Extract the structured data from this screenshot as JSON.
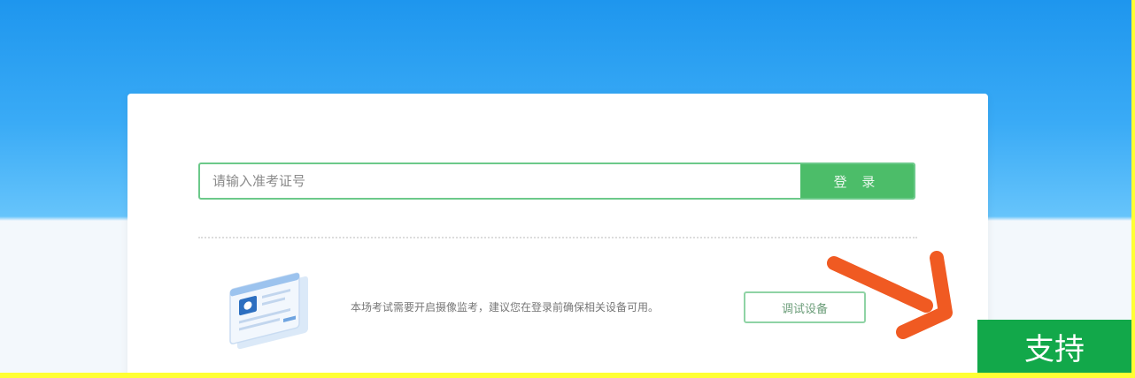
{
  "login": {
    "input_placeholder": "请输入准考证号",
    "input_value": "",
    "button_label": "登 录"
  },
  "device_check": {
    "notice": "本场考试需要开启摄像监考，建议您在登录前确保相关设备可用。",
    "button_label": "调试设备"
  },
  "support": {
    "button_label": "支持"
  },
  "colors": {
    "accent_green": "#4cbd69",
    "support_green": "#12a84a",
    "arrow_orange": "#f05a22",
    "frame_yellow": "#ffff33",
    "sky_blue": "#2aa3f3"
  },
  "icons": [
    "exam-document-illustration",
    "pointer-arrow"
  ]
}
